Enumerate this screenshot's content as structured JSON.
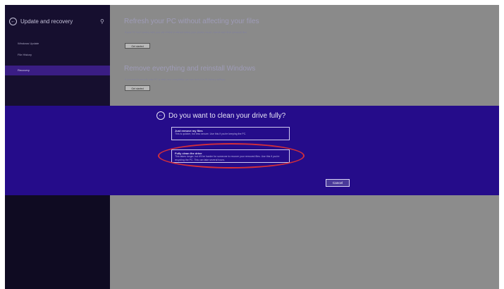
{
  "sidebar": {
    "title": "Update and recovery",
    "items": [
      {
        "label": "Windows Update"
      },
      {
        "label": "File History"
      },
      {
        "label": "Recovery"
      }
    ]
  },
  "main": {
    "refresh": {
      "title": "Refresh your PC without affecting your files",
      "description": "If your PC isn't running well, you can refresh it without losing your photos, music, videos and other personal files.",
      "button": "Get started"
    },
    "reset": {
      "title": "Remove everything and reinstall Windows",
      "description": "If you want to recycle your PC or start over completely, you can reset it to its factory settings.",
      "button": "Get started"
    }
  },
  "dialog": {
    "title": "Do you want to clean your drive fully?",
    "options": [
      {
        "title": "Just remove my files",
        "desc": "This is quicker, but less secure. Use this if you're keeping the PC."
      },
      {
        "title": "Fully clean the drive",
        "desc": "This takes longer, but it'll be harder for someone to recover your removed files. Use this if you're recycling the PC. This can take several hours."
      }
    ],
    "cancel": "Cancel"
  },
  "colors": {
    "accent": "#250c8a",
    "sidebar": "#160f2f",
    "highlight": "#d32f3a"
  }
}
